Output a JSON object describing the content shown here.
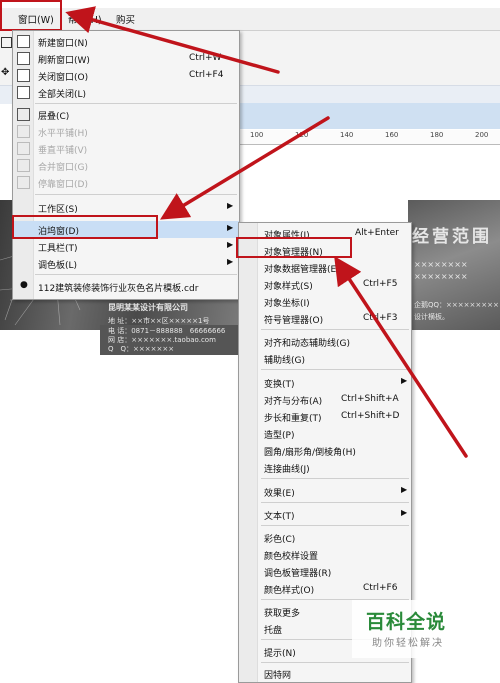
{
  "menubar": {
    "window": "窗口(W)",
    "help": "帮助(H)",
    "buy": "购买"
  },
  "window_menu": [
    {
      "label": "新建窗口(N)",
      "shortcut": "",
      "icon": "new-window-icon"
    },
    {
      "label": "刷新窗口(W)",
      "shortcut": "Ctrl+W",
      "icon": "refresh-window-icon"
    },
    {
      "label": "关闭窗口(O)",
      "shortcut": "Ctrl+F4",
      "icon": "close-window-icon"
    },
    {
      "label": "全部关闭(L)",
      "shortcut": "",
      "icon": "close-all-icon"
    },
    {
      "label": "层叠(C)",
      "shortcut": "",
      "icon": "cascade-icon"
    },
    {
      "label": "水平平铺(H)",
      "disabled": true,
      "icon": "tile-horizontal-icon"
    },
    {
      "label": "垂直平铺(V)",
      "disabled": true,
      "icon": "tile-vertical-icon"
    },
    {
      "label": "合并窗口(G)",
      "disabled": true,
      "icon": "merge-window-icon"
    },
    {
      "label": "停靠窗口(D)",
      "disabled": true,
      "icon": "dock-window-icon"
    },
    {
      "label": "工作区(S)"
    },
    {
      "label": "泊坞窗(D)"
    },
    {
      "label": "工具栏(T)"
    },
    {
      "label": "调色板(L)"
    },
    {
      "label": "112建筑装修装饰行业灰色名片模板.cdr"
    }
  ],
  "docker_menu": [
    {
      "label": "对象属性(I)",
      "shortcut": "Alt+Enter"
    },
    {
      "label": "对象管理器(N)",
      "shortcut": ""
    },
    {
      "label": "对象数据管理器(E)",
      "shortcut": ""
    },
    {
      "label": "对象样式(S)",
      "shortcut": "Ctrl+F5"
    },
    {
      "label": "对象坐标(I)",
      "shortcut": ""
    },
    {
      "label": "符号管理器(O)",
      "shortcut": "Ctrl+F3"
    },
    {
      "label": "对齐和动态辅助线(G)",
      "shortcut": ""
    },
    {
      "label": "辅助线(G)",
      "shortcut": ""
    },
    {
      "label": "变换(T)",
      "shortcut": ""
    },
    {
      "label": "对齐与分布(A)",
      "shortcut": "Ctrl+Shift+A"
    },
    {
      "label": "步长和重复(T)",
      "shortcut": "Ctrl+Shift+D"
    },
    {
      "label": "造型(P)",
      "shortcut": ""
    },
    {
      "label": "圆角/扇形角/倒棱角(H)",
      "shortcut": ""
    },
    {
      "label": "连接曲线(J)",
      "shortcut": ""
    },
    {
      "label": "效果(E)",
      "shortcut": ""
    },
    {
      "label": "文本(T)",
      "shortcut": ""
    },
    {
      "label": "彩色(C)",
      "shortcut": ""
    },
    {
      "label": "颜色校样设置",
      "shortcut": ""
    },
    {
      "label": "调色板管理器(R)",
      "shortcut": ""
    },
    {
      "label": "颜色样式(O)",
      "shortcut": "Ctrl+F6"
    },
    {
      "label": "获取更多",
      "shortcut": ""
    },
    {
      "label": "托盘",
      "shortcut": ""
    },
    {
      "label": "提示(N)",
      "shortcut": ""
    },
    {
      "label": "因特网",
      "shortcut": ""
    }
  ],
  "ruler": [
    "100",
    "120",
    "140",
    "160",
    "180",
    "200"
  ],
  "card": {
    "company": "昆明某某设计有限公司",
    "address": "地 址：××市××区×××××1号",
    "phone": "电 话：0871－888888　66666666",
    "shop": "网 店：×××××××.taobao.com",
    "qq": "Q　Q：×××××××",
    "right_title": "经营范围",
    "right_line": "××××××××",
    "right_qq": "企鹅QQ：××××××××× ×",
    "right_note": "设计横板。"
  },
  "watermark": {
    "title": "百科全说",
    "subtitle": "助你轻松解决"
  },
  "accent_color": "#c0141b"
}
